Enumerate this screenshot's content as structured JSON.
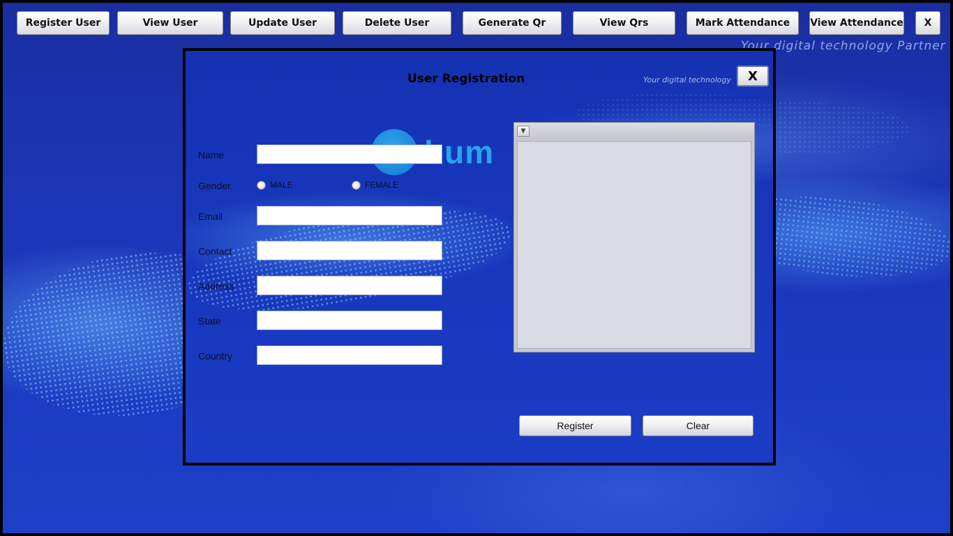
{
  "topbar": {
    "buttons": [
      {
        "label": "Register User"
      },
      {
        "label": "View User"
      },
      {
        "label": "Update User"
      },
      {
        "label": "Delete User"
      },
      {
        "label": "Generate Qr"
      },
      {
        "label": "View Qrs"
      },
      {
        "label": "Mark Attendance"
      },
      {
        "label": "View Attendance"
      },
      {
        "label": "X"
      }
    ],
    "tagline": "Your digital technology Partner"
  },
  "dialog": {
    "title": "User Registration",
    "tagline": "Your digital technology",
    "close_label": "X",
    "logo_text": "bum",
    "form": {
      "name_label": "Name",
      "name_value": "",
      "gender_label": "Gender",
      "gender_options": [
        "MALE",
        "FEMALE"
      ],
      "email_label": "Email",
      "email_value": "",
      "contact_label": "Contact",
      "contact_value": "",
      "address_label": "Address",
      "address_value": "",
      "state_label": "State",
      "state_value": "",
      "country_label": "Country",
      "country_value": ""
    },
    "register_label": "Register",
    "clear_label": "Clear"
  },
  "colors": {
    "background": "#1a37bd",
    "logo_accent": "#27a4ec"
  }
}
